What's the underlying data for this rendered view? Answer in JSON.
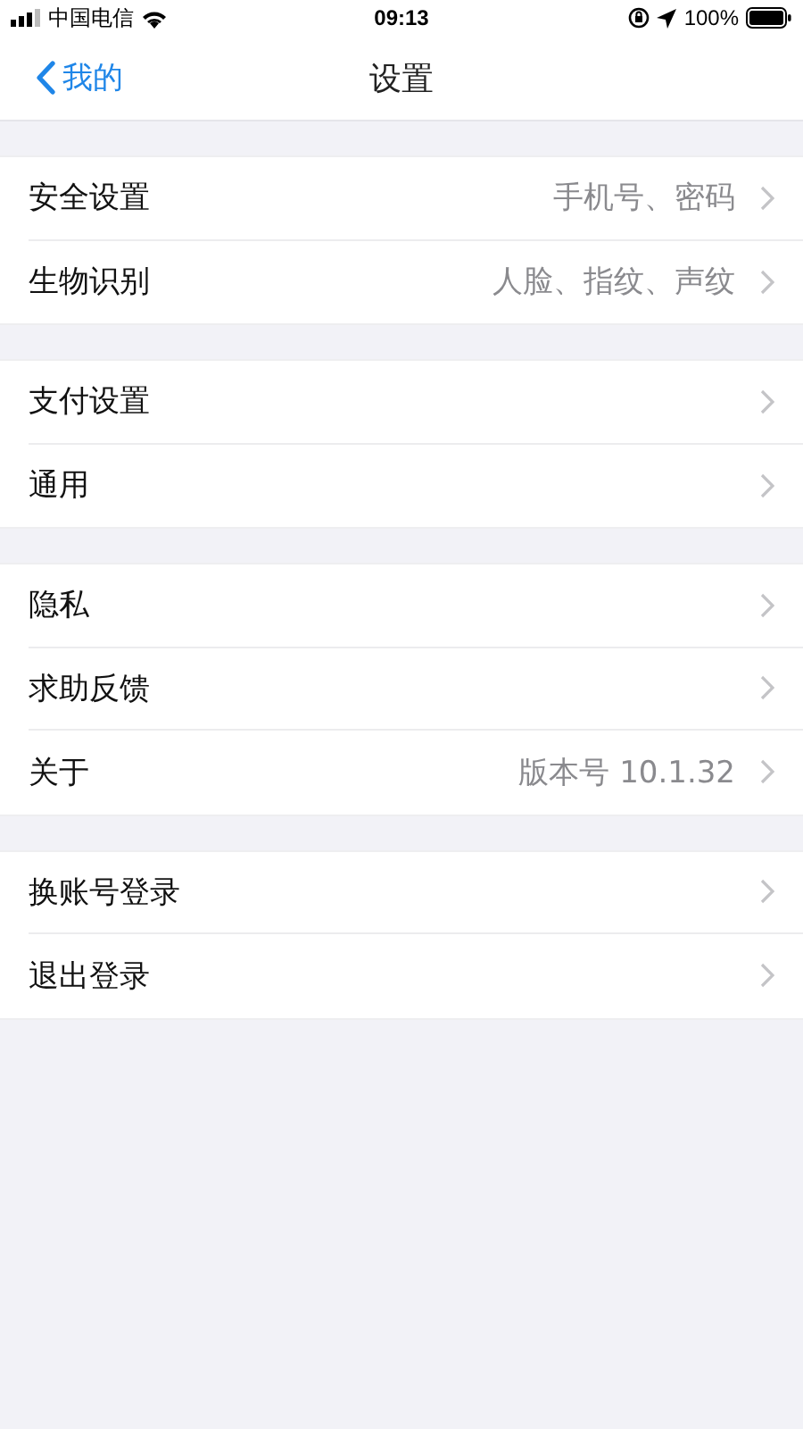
{
  "status_bar": {
    "carrier": "中国电信",
    "time": "09:13",
    "battery": "100%"
  },
  "nav": {
    "back": "我的",
    "title": "设置"
  },
  "groups": [
    {
      "rows": [
        {
          "label": "安全设置",
          "detail": "手机号、密码"
        },
        {
          "label": "生物识别",
          "detail": "人脸、指纹、声纹"
        }
      ]
    },
    {
      "rows": [
        {
          "label": "支付设置"
        },
        {
          "label": "通用"
        }
      ]
    },
    {
      "rows": [
        {
          "label": "隐私"
        },
        {
          "label": "求助反馈"
        },
        {
          "label": "关于",
          "detail": "版本号 10.1.32"
        }
      ]
    },
    {
      "rows": [
        {
          "label": "换账号登录"
        },
        {
          "label": "退出登录"
        }
      ]
    }
  ]
}
